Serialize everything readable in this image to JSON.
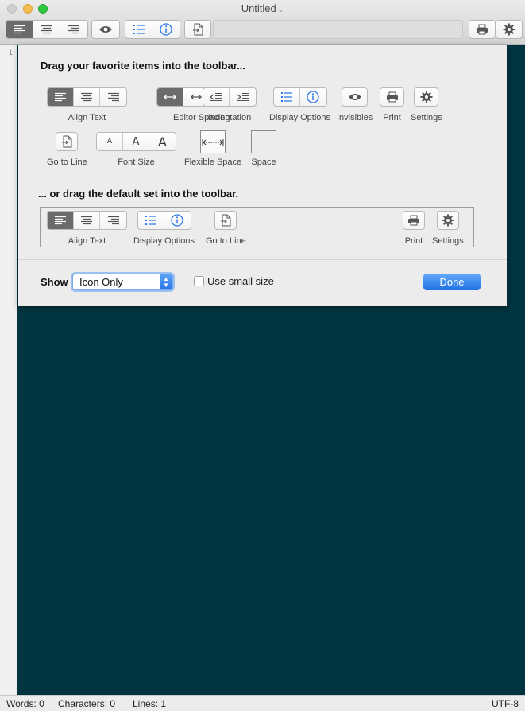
{
  "window": {
    "title": "Untitled"
  },
  "toolbar": {
    "address_value": ""
  },
  "gutter": {
    "first_line": "1"
  },
  "sheet": {
    "heading_favorites": "Drag your favorite items into the toolbar...",
    "heading_default": "... or drag the default set into the toolbar.",
    "items": {
      "align_text": "Align Text",
      "editor_spacing": "Editor Spacing",
      "indentation": "Indentation",
      "display_options": "Display Options",
      "invisibles": "Invisibles",
      "print": "Print",
      "settings": "Settings",
      "go_to_line": "Go to Line",
      "font_size": "Font Size",
      "font_size_glyph": "A",
      "flexible_space": "Flexible Space",
      "space": "Space"
    },
    "default_set": {
      "align_text": "Align Text",
      "display_options": "Display Options",
      "go_to_line": "Go to Line",
      "print": "Print",
      "settings": "Settings"
    },
    "show_label": "Show",
    "show_select": {
      "value": "Icon Only"
    },
    "small_size": {
      "label": "Use small size",
      "checked": false
    },
    "done_label": "Done"
  },
  "status": {
    "words": "Words: 0",
    "characters": "Characters: 0",
    "lines": "Lines: 1",
    "encoding": "UTF-8"
  },
  "colors": {
    "editor_background": "#003540",
    "accent": "#2a7ae9",
    "active_segment": "#6b6b6b"
  },
  "icons": [
    "align-left-icon",
    "align-center-icon",
    "align-right-icon",
    "eye-icon",
    "numbered-list-icon",
    "info-icon",
    "go-to-line-icon",
    "printer-icon",
    "gear-icon",
    "spacing-expand-icon",
    "spacing-contract-icon",
    "outdent-icon",
    "indent-icon",
    "flexible-space-icon"
  ]
}
